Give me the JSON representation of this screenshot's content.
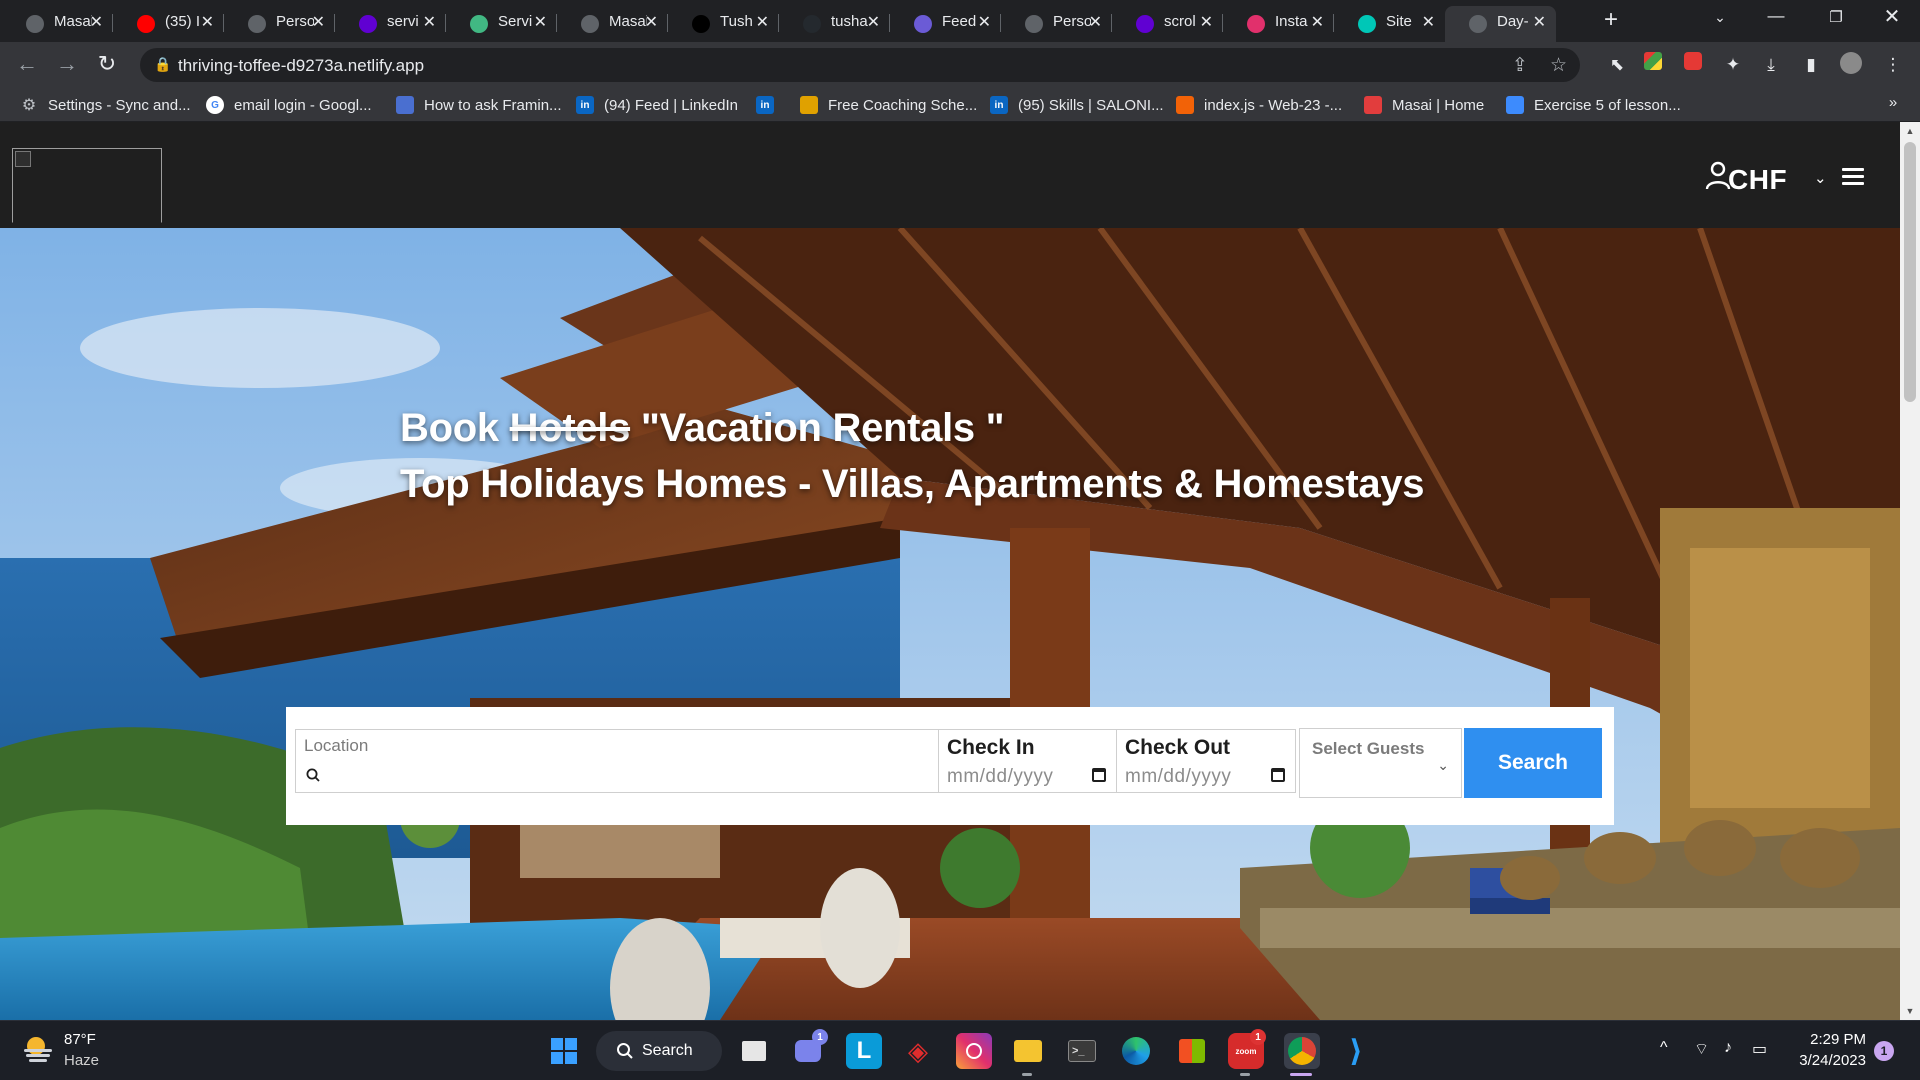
{
  "browser": {
    "tabs": [
      {
        "label": "Masai",
        "icon": "globe-icon",
        "color": "#5f6368"
      },
      {
        "label": "(35) I",
        "icon": "youtube-icon",
        "color": "#ff0000"
      },
      {
        "label": "Perso",
        "icon": "globe-icon",
        "color": "#5f6368"
      },
      {
        "label": "servi",
        "icon": "yahoo-icon",
        "color": "#6001d2"
      },
      {
        "label": "Servi",
        "icon": "vue-icon",
        "color": "#41b883"
      },
      {
        "label": "Masai",
        "icon": "globe-icon",
        "color": "#5f6368"
      },
      {
        "label": "Tush",
        "icon": "vercel-icon",
        "color": "#000000"
      },
      {
        "label": "tusha",
        "icon": "github-icon",
        "color": "#24292e"
      },
      {
        "label": "Feed",
        "icon": "list-icon",
        "color": "#6b5bd6"
      },
      {
        "label": "Perso",
        "icon": "globe-icon",
        "color": "#5f6368"
      },
      {
        "label": "scrol",
        "icon": "yahoo-icon",
        "color": "#6001d2"
      },
      {
        "label": "Insta",
        "icon": "insta-bars-icon",
        "color": "#e1306c"
      },
      {
        "label": "Site",
        "icon": "netlify-icon",
        "color": "#00c7b7"
      },
      {
        "label": "Day-",
        "icon": "globe-icon",
        "color": "#5f6368"
      }
    ],
    "active_tab_index": 13,
    "url": "thriving-toffee-d9273a.netlify.app",
    "bookmarks": [
      {
        "label": "Settings - Sync and...",
        "icon": "gear-icon",
        "color": "#9aa0a6"
      },
      {
        "label": "email login - Googl...",
        "icon": "google-icon",
        "color": "#ffffff"
      },
      {
        "label": "How to ask Framin...",
        "icon": "translate-icon",
        "color": "#4a6fd0"
      },
      {
        "label": "(94) Feed | LinkedIn",
        "icon": "linkedin-icon",
        "color": "#0a66c2"
      },
      {
        "label": "",
        "icon": "linkedin-icon",
        "color": "#0a66c2"
      },
      {
        "label": "Free Coaching Sche...",
        "icon": "trophy-icon",
        "color": "#e0a100"
      },
      {
        "label": "(95) Skills | SALONI...",
        "icon": "linkedin-icon",
        "color": "#0a66c2"
      },
      {
        "label": "index.js - Web-23 -...",
        "icon": "replit-icon",
        "color": "#f26207"
      },
      {
        "label": "Masai | Home",
        "icon": "masai-icon",
        "color": "#e23d3d"
      },
      {
        "label": "Exercise 5 of lesson...",
        "icon": "r-icon",
        "color": "#3d8bfd"
      }
    ]
  },
  "site": {
    "header": {
      "currency": "CHF"
    },
    "hero": {
      "line1_prefix": "Book ",
      "line1_strike": "Hotels",
      "line1_suffix": " \"Vacation Rentals \"",
      "line2": "Top Holidays Homes - Villas, Apartments & Homestays"
    },
    "search": {
      "location_label": "Location",
      "checkin_label": "Check In",
      "checkin_placeholder": "mm/dd/yyyy",
      "checkout_label": "Check Out",
      "checkout_placeholder": "mm/dd/yyyy",
      "guests_placeholder": "Select Guests",
      "button_label": "Search"
    }
  },
  "taskbar": {
    "weather_temp": "87°F",
    "weather_condition": "Haze",
    "search_label": "Search",
    "time": "2:29 PM",
    "date": "3/24/2023",
    "notification_count": "1",
    "teams_badge": "1",
    "zoom_badge": "1"
  }
}
